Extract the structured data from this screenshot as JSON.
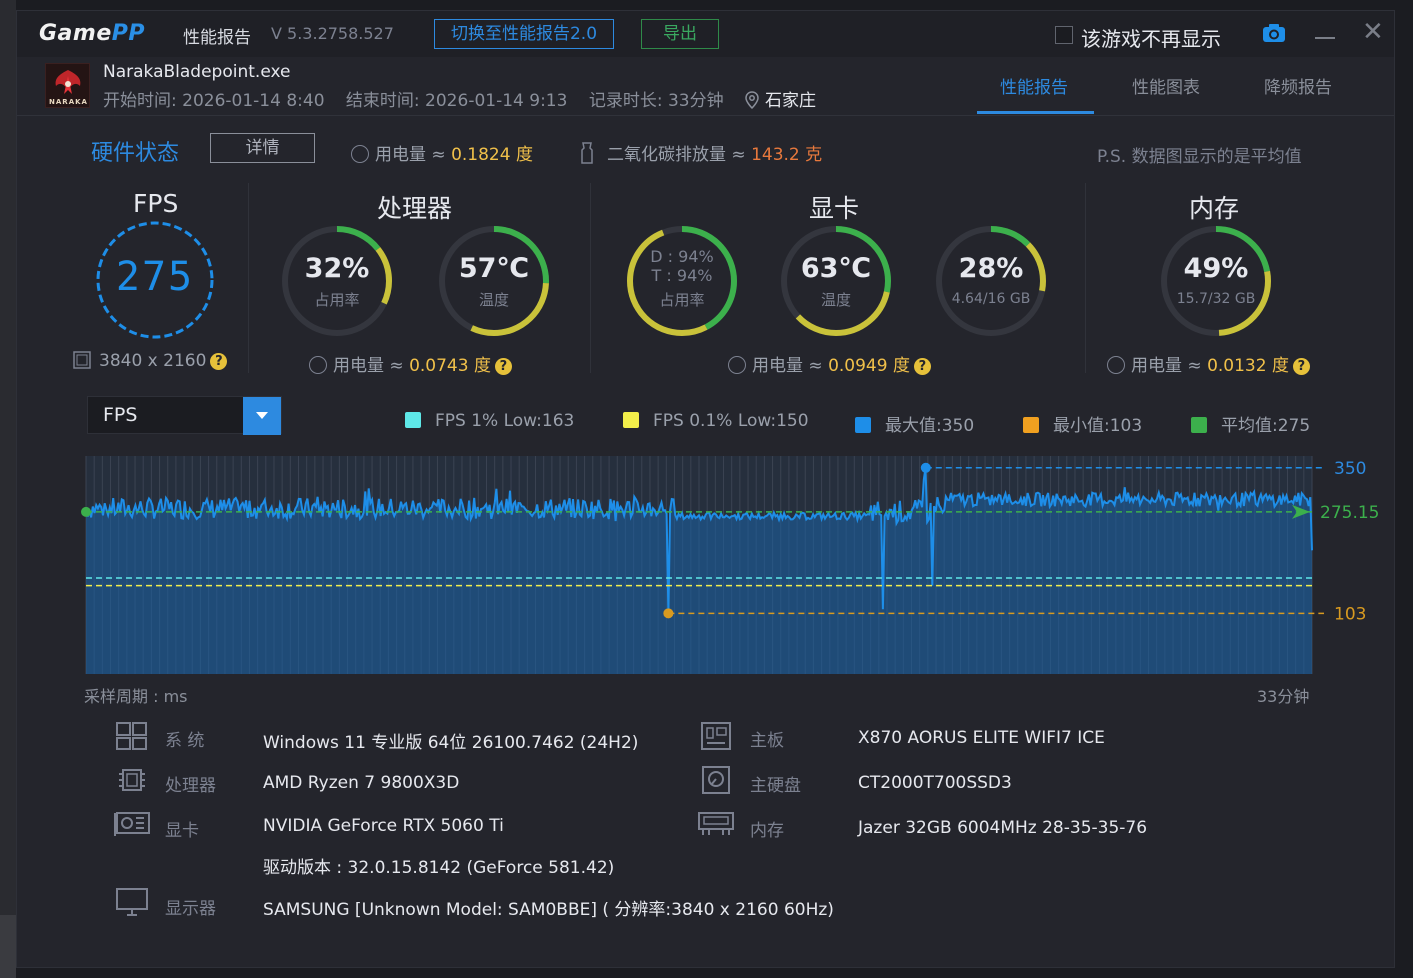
{
  "titlebar": {
    "logo_game": "Game",
    "logo_pp": "PP",
    "title": "性能报告",
    "version": "V 5.3.2758.527",
    "switch_button": "切换至性能报告2.0",
    "export_button": "导出",
    "dont_show_label": "该游戏不再显示"
  },
  "game": {
    "exe": "NarakaBladepoint.exe",
    "icon_text": "NARAKA",
    "start_time": "开始时间: 2026-01-14 8:40",
    "end_time": "结束时间: 2026-01-14 9:13",
    "duration": "记录时长: 33分钟",
    "location": "石家庄"
  },
  "tabs": [
    {
      "label": "性能报告",
      "active": true
    },
    {
      "label": "性能图表",
      "active": false
    },
    {
      "label": "降频报告",
      "active": false
    }
  ],
  "hardware": {
    "title": "硬件状态",
    "detail_button": "详情",
    "power_label": "用电量 ≈ ",
    "power_value": "0.1824 度",
    "co2_label": "二氧化碳排放量 ≈ ",
    "co2_value": "143.2 克",
    "note": "P.S. 数据图显示的是平均值"
  },
  "sections": {
    "fps": {
      "title": "FPS",
      "value": "275",
      "resolution": "3840 x 2160"
    },
    "cpu": {
      "title": "处理器",
      "usage": "32%",
      "usage_fraction": 0.32,
      "usage_label": "占用率",
      "temp": "57℃",
      "temp_fraction": 0.57,
      "temp_label": "温度",
      "power_label": "用电量 ≈ ",
      "power_value": "0.0743 度"
    },
    "gpu": {
      "title": "显卡",
      "usage_d": "D : 94%",
      "usage_t": "T : 94%",
      "usage_fraction": 0.94,
      "usage_label": "占用率",
      "temp": "63℃",
      "temp_fraction": 0.63,
      "temp_label": "温度",
      "mem": "28%",
      "mem_fraction": 0.28,
      "mem_detail": "4.64/16 GB",
      "power_label": "用电量 ≈ ",
      "power_value": "0.0949 度"
    },
    "memory": {
      "title": "内存",
      "usage": "49%",
      "usage_fraction": 0.49,
      "detail": "15.7/32 GB",
      "power_label": "用电量 ≈ ",
      "power_value": "0.0132 度"
    }
  },
  "chart_controls": {
    "selected_metric": "FPS",
    "legend": [
      {
        "label": "FPS 1% Low:163",
        "color": "#5ee8e8"
      },
      {
        "label": "FPS 0.1% Low:150",
        "color": "#f2ee4a"
      },
      {
        "label": "最大值:350",
        "color": "#1e8ee8"
      },
      {
        "label": "最小值:103",
        "color": "#f0a020"
      },
      {
        "label": "平均值:275",
        "color": "#3cb04c"
      }
    ]
  },
  "chart_data": {
    "type": "area",
    "series": [
      {
        "name": "FPS"
      }
    ],
    "x_start_label": "采样周期 : ms",
    "x_end_label": "33分钟",
    "ylim": [
      0,
      370
    ],
    "max": 350,
    "max_label": "350",
    "min": 103,
    "min_label": "103",
    "avg": 275.15,
    "avg_label": "275.15",
    "low_1pct": 163,
    "low_01pct": 150,
    "max_at": 0.685,
    "min_at": 0.475,
    "segments": [
      {
        "from": 0.0,
        "to": 0.48,
        "level": 281,
        "jitter": 18
      },
      {
        "from": 0.48,
        "to": 0.64,
        "level": 268,
        "jitter": 6
      },
      {
        "from": 0.64,
        "to": 0.7,
        "level": 275,
        "jitter": 20
      },
      {
        "from": 0.7,
        "to": 1.0,
        "level": 296,
        "jitter": 12
      }
    ],
    "grid": true
  },
  "system_info": {
    "os_label": "系  统",
    "os_value": "Windows 11 专业版 64位 26100.7462 (24H2)",
    "cpu_label": "处理器",
    "cpu_value": "AMD Ryzen 7 9800X3D",
    "gpu_label": "显卡",
    "gpu_value": "NVIDIA GeForce RTX 5060 Ti",
    "driver_value": "驱动版本 : 32.0.15.8142 (GeForce 581.42)",
    "monitor_label": "显示器",
    "monitor_value": "SAMSUNG [Unknown Model: SAM0BBE] ( 分辨率:3840 x 2160 60Hz)",
    "mb_label": "主板",
    "mb_value": "X870 AORUS ELITE WIFI7 ICE",
    "disk_label": "主硬盘",
    "disk_value": "CT2000T700SSD3",
    "ram_label": "内存",
    "ram_value": "Jazer 32GB 6004MHz 28-35-35-76"
  },
  "colors": {
    "accent": "#2d8ae0",
    "gauge_green": "#3cb04c",
    "gauge_yellow": "#c9c23a",
    "power_value": "#f0c04a",
    "co2_value": "#e8793d"
  }
}
